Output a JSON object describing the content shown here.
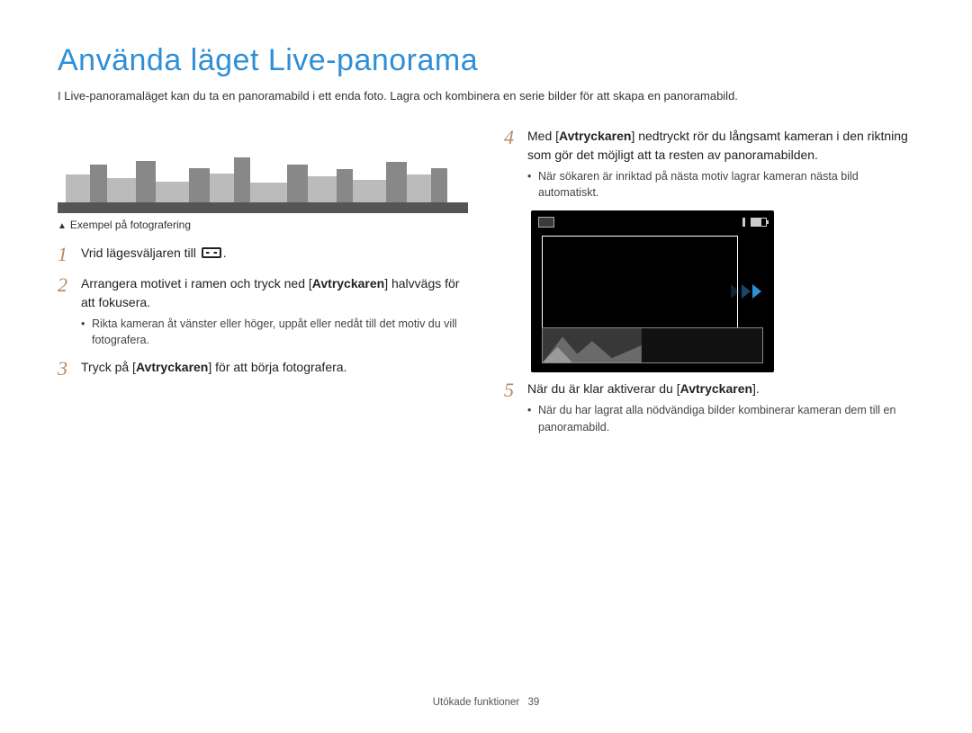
{
  "title": "Använda läget Live-panorama",
  "intro": "I Live-panoramaläget kan du ta en panoramabild i ett enda foto. Lagra och kombinera en serie bilder för att skapa en panoramabild.",
  "example_caption": "Exempel på fotografering",
  "left_steps": {
    "s1": {
      "num": "1",
      "text_a": "Vrid lägesväljaren till ",
      "text_b": "."
    },
    "s2": {
      "num": "2",
      "text_a": "Arrangera motivet i ramen och tryck ned [",
      "bold": "Avtryckaren",
      "text_b": "] halvvägs för att fokusera.",
      "bullet": "Rikta kameran åt vänster eller höger, uppåt eller nedåt till det motiv du vill fotografera."
    },
    "s3": {
      "num": "3",
      "text_a": "Tryck på [",
      "bold": "Avtryckaren",
      "text_b": "] för att börja fotografera."
    }
  },
  "right_steps": {
    "s4": {
      "num": "4",
      "text_a": "Med [",
      "bold": "Avtryckaren",
      "text_b": "] nedtryckt rör du långsamt kameran i den riktning som gör det möjligt att ta resten av panoramabilden.",
      "bullet": "När sökaren är inriktad på nästa motiv lagrar kameran nästa bild automatiskt."
    },
    "s5": {
      "num": "5",
      "text_a": "När du är klar aktiverar du [",
      "bold": "Avtryckaren",
      "text_b": "].",
      "bullet": "När du har lagrat alla nödvändiga bilder kombinerar kameran dem till en panoramabild."
    }
  },
  "footer": {
    "section": "Utökade funktioner",
    "page": "39"
  }
}
